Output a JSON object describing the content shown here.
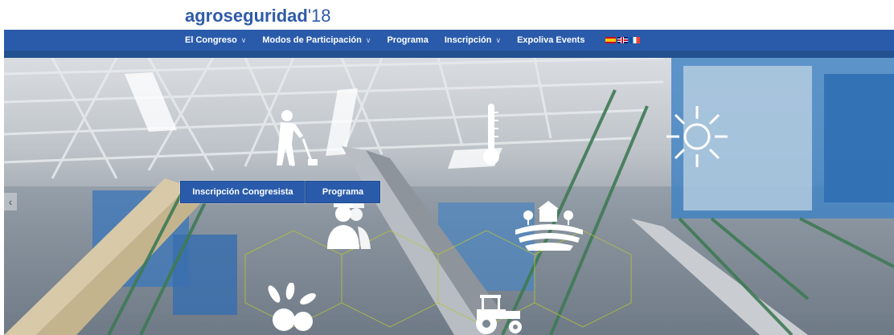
{
  "logo": {
    "brand": "agroseguridad",
    "year": "'18"
  },
  "nav": {
    "items": [
      {
        "label": "El Congreso",
        "dropdown": true
      },
      {
        "label": "Modos de Participación",
        "dropdown": true
      },
      {
        "label": "Programa",
        "dropdown": false
      },
      {
        "label": "Inscripción",
        "dropdown": true
      },
      {
        "label": "Expoliva Events",
        "dropdown": false
      }
    ],
    "flags": [
      "flag-spain-icon",
      "flag-uk-icon",
      "flag-france-icon"
    ]
  },
  "hero": {
    "buttons": {
      "inscripcion": "Inscripción Congresista",
      "programa": "Programa"
    },
    "icons": [
      "worker-icon",
      "thermometer-icon",
      "sun-icon",
      "workers-group-icon",
      "farm-field-icon",
      "olives-icon",
      "tractor-icon"
    ]
  },
  "colors": {
    "brand": "#2f5ba8",
    "nav_bg": "#2a5bab",
    "button_bg": "#2a5bab"
  }
}
